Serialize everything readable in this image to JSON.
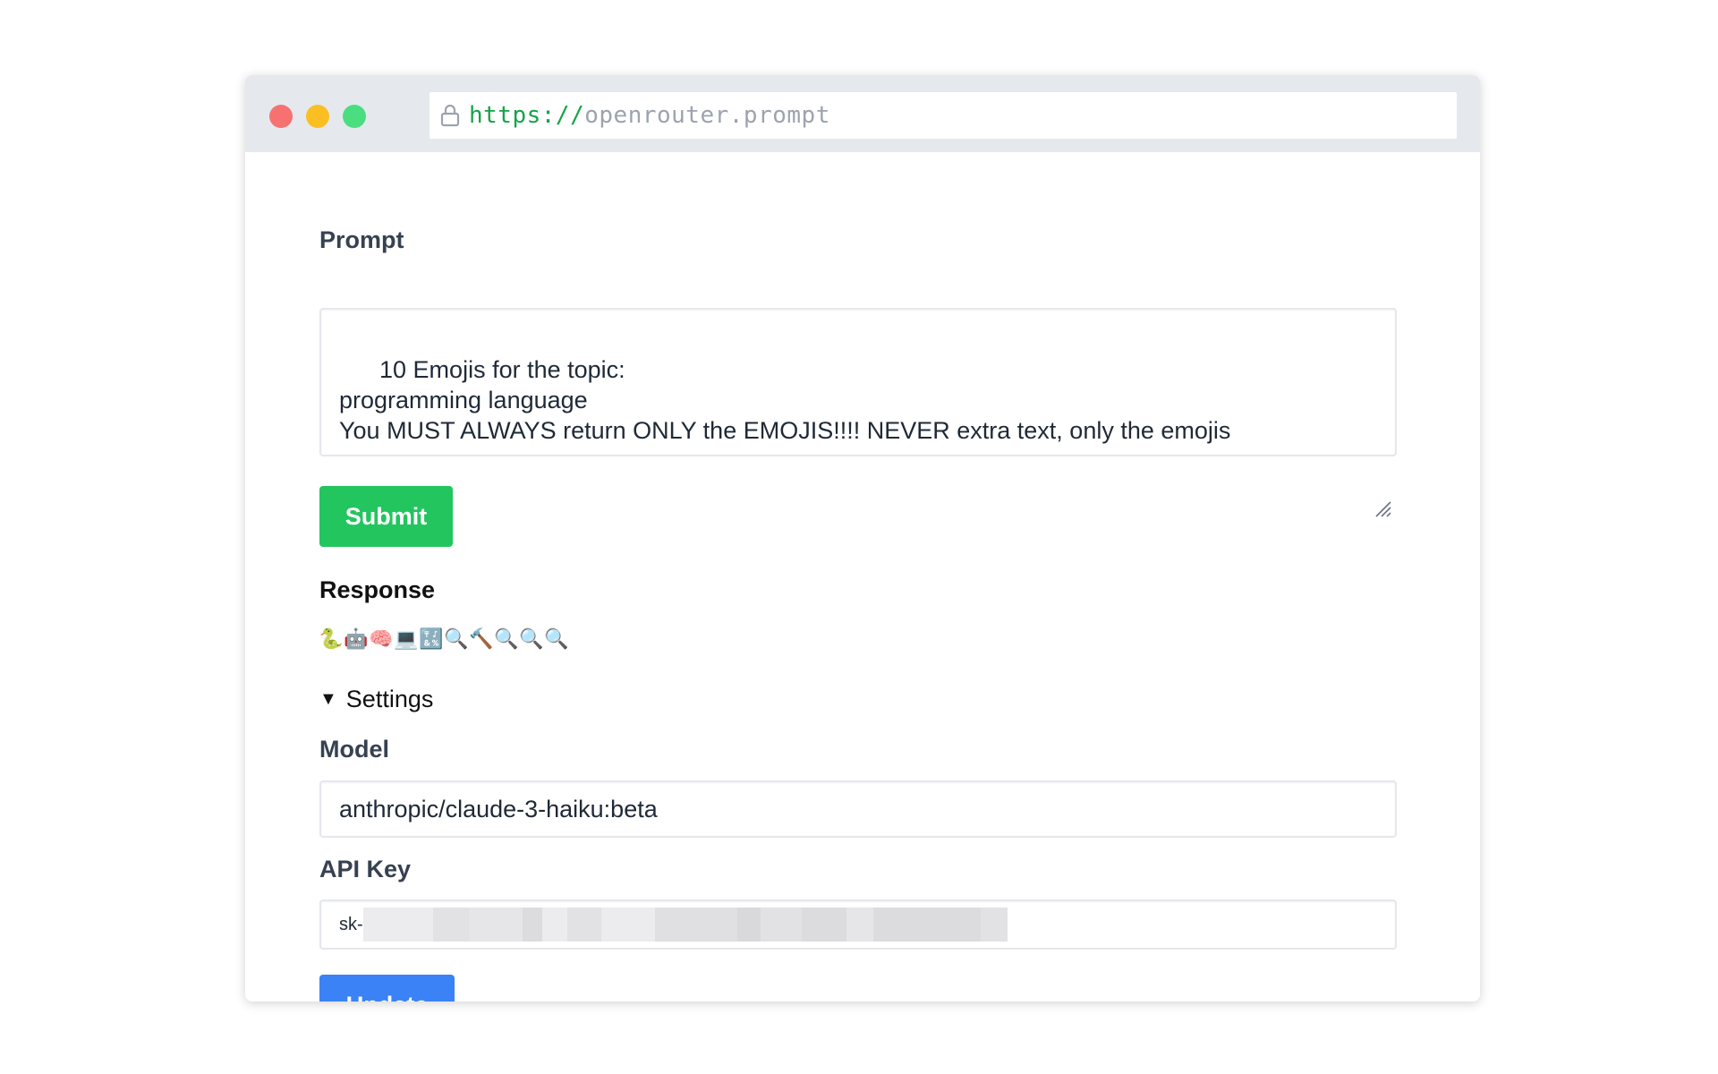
{
  "browser": {
    "url_scheme": "https://",
    "url_host": "openrouter.prompt",
    "traffic_lights": {
      "close": "#f87171",
      "minimize": "#fbbf24",
      "maximize": "#4ade80"
    }
  },
  "prompt": {
    "label": "Prompt",
    "value": "10 Emojis for the topic:\nprogramming language\nYou MUST ALWAYS return ONLY the EMOJIS!!!! NEVER extra text, only the emojis"
  },
  "submit": {
    "label": "Submit",
    "color": "#22c55e"
  },
  "response": {
    "title": "Response",
    "emojis": [
      "🐍",
      "🤖",
      "🧠",
      "💻",
      "🔣",
      "🔍",
      "🔨",
      "🔍",
      "🔍",
      "🔍"
    ]
  },
  "settings": {
    "toggle_label": "Settings",
    "model_label": "Model",
    "model_value": "anthropic/claude-3-haiku:beta",
    "api_key_label": "API Key",
    "api_key_prefix": "sk-",
    "update_label": "Update",
    "update_color": "#3b82f6"
  }
}
